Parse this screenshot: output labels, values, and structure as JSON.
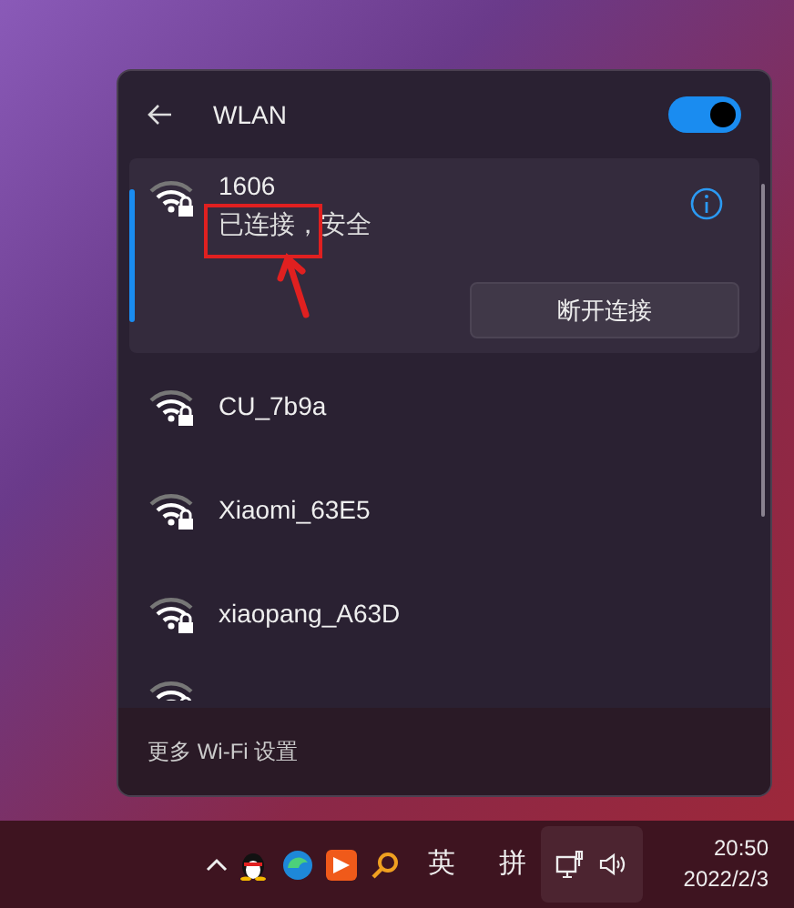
{
  "panel": {
    "title": "WLAN",
    "wifi_on": true
  },
  "networks": [
    {
      "name": "1606",
      "status": "已连接，安全",
      "selected": true,
      "action": "断开连接"
    },
    {
      "name": "CU_7b9a",
      "selected": false
    },
    {
      "name": "Xiaomi_63E5",
      "selected": false
    },
    {
      "name": "xiaopang_A63D",
      "selected": false
    }
  ],
  "footer": {
    "link": "更多 Wi-Fi 设置"
  },
  "taskbar": {
    "ime_mode": "英",
    "ime": "拼",
    "time": "20:50",
    "date": "2022/2/3"
  }
}
